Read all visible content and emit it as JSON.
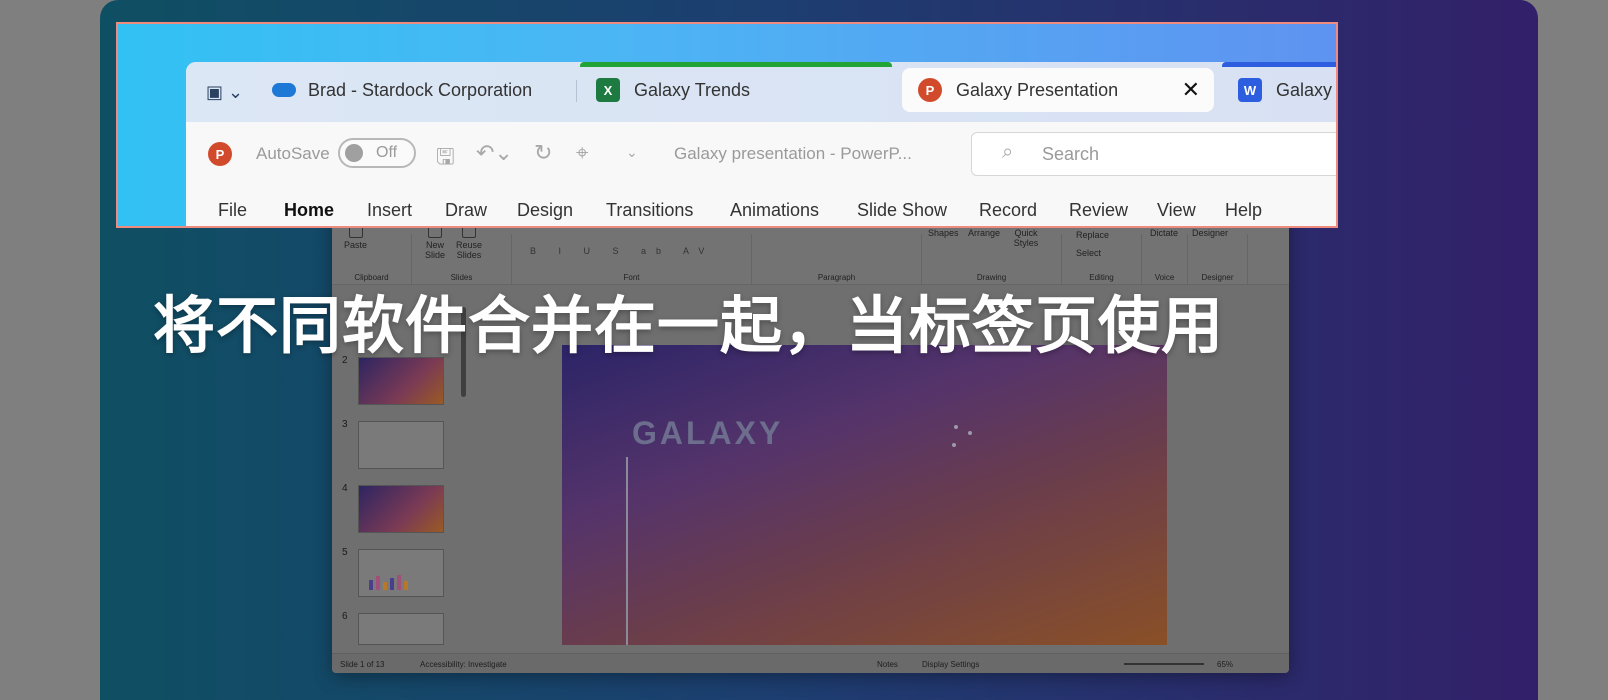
{
  "headline": "将不同软件合并在一起，当标签页使用",
  "tabs": [
    {
      "label": "Brad - Stardock Corporation",
      "icon": "onedrive-cloud-icon",
      "accent": "",
      "active": false
    },
    {
      "label": "Galaxy Trends",
      "icon": "excel-icon",
      "icon_text": "X",
      "accent": "#21a336",
      "active": false
    },
    {
      "label": "Galaxy Presentation",
      "icon": "powerpoint-icon",
      "icon_text": "P",
      "active": true
    },
    {
      "label": "Galaxy Sc",
      "icon": "word-icon",
      "icon_text": "W",
      "accent": "#2e5ee0",
      "active": false
    }
  ],
  "tab_close_glyph": "✕",
  "toolbar": {
    "app_badge": "P",
    "autosave_label": "AutoSave",
    "autosave_state": "Off",
    "document_title": "Galaxy presentation  -  PowerP...",
    "search_placeholder": "Search"
  },
  "menu": [
    "File",
    "Home",
    "Insert",
    "Draw",
    "Design",
    "Transitions",
    "Animations",
    "Slide Show",
    "Record",
    "Review",
    "View",
    "Help"
  ],
  "active_menu": "Home",
  "ribbon": {
    "paste": "Paste",
    "new_slide": "New Slide",
    "reuse_slides": "Reuse Slides",
    "shapes": "Shapes",
    "arrange": "Arrange",
    "quick_styles": "Quick Styles",
    "replace": "Replace",
    "select": "Select",
    "dictate": "Dictate",
    "designer": "Designer",
    "groups": {
      "clipboard": "Clipboard",
      "slides": "Slides",
      "font": "Font",
      "paragraph": "Paragraph",
      "drawing": "Drawing",
      "editing": "Editing",
      "voice": "Voice",
      "designer": "Designer"
    },
    "font_buttons": "B I U S ab AV"
  },
  "slide_numbers": [
    "2",
    "3",
    "4",
    "5",
    "6"
  ],
  "slide_title": "GALAXY",
  "status": {
    "slide_info": "Slide 1 of 13",
    "accessibility": "Accessibility: Investigate",
    "notes": "Notes",
    "display_settings": "Display Settings",
    "zoom": "65%"
  },
  "colors": {
    "excel_green": "#21a336",
    "powerpoint_red": "#d14a2b",
    "word_blue": "#2e5ee0",
    "frame_border": "#ef8b7e"
  }
}
